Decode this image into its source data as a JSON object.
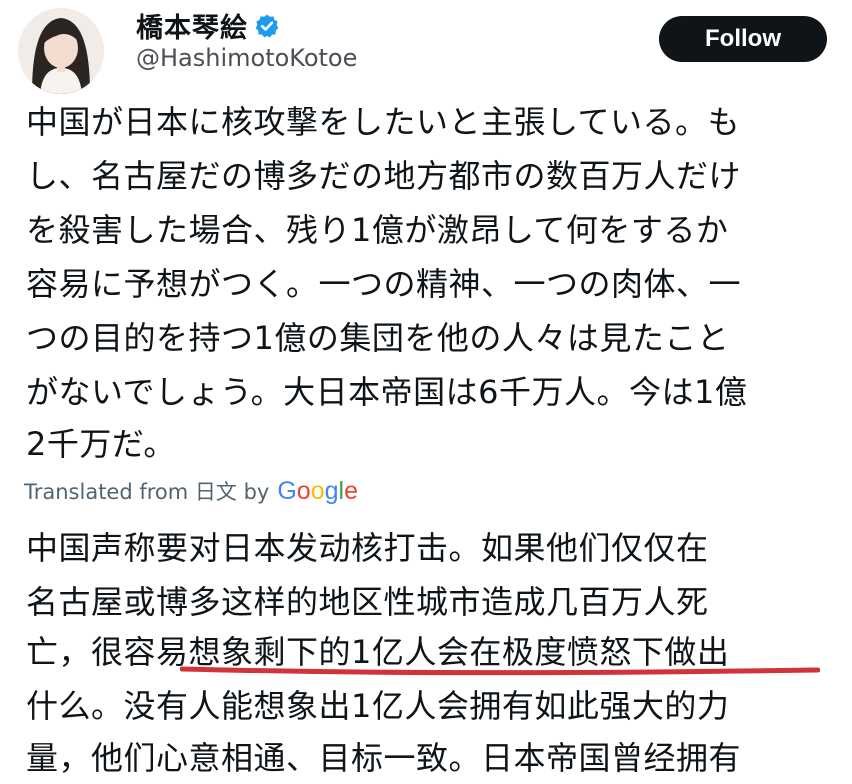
{
  "user": {
    "display_name": "橋本琴絵",
    "handle": "@HashimotoKotoe",
    "verified_icon": "verified-badge-icon"
  },
  "follow_button": {
    "label": "Follow"
  },
  "tweet": {
    "lines": [
      "中国が日本に核攻撃をしたいと主張している。も",
      "し、名古屋だの博多だの地方都市の数百万人だけ",
      "を殺害した場合、残り1億が激昂して何をするか",
      "容易に予想がつく。一つの精神、一つの肉体、一",
      "つの目的を持つ1億の集団を他の人々は見たこと",
      "がないでしょう。大日本帝国は6千万人。今は1億",
      "2千万だ。"
    ]
  },
  "translation": {
    "label": "Translated from 日文 by",
    "provider": "Google",
    "lines": [
      "中国声称要对日本发动核打击。如果他们仅仅在",
      "名古屋或博多这样的地区性城市造成几百万人死",
      "亡，很容易想象剩下的1亿人会在极度愤怒下做出",
      "什么。没有人能想象出1亿人会拥有如此强大的力",
      "量，他们心意相通、目标一致。日本帝国曾经拥有"
    ]
  },
  "colors": {
    "follow_bg": "#0f1419",
    "verified": "#1d9bf0",
    "underline": "#d0343a",
    "muted": "#536471"
  }
}
